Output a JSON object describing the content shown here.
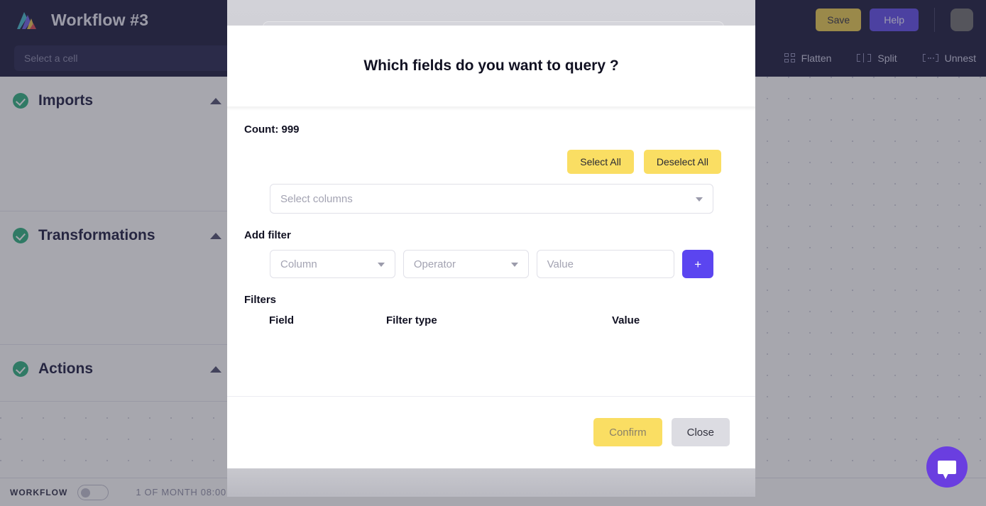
{
  "header": {
    "app_title": "Workflow #3",
    "logo_icon": "lyra-triangle-logo",
    "save_label": "Save",
    "help_label": "Help",
    "avatar_icon": "user-avatar",
    "cell_placeholder": "Select a cell",
    "tools": [
      {
        "label": "Flatten",
        "icon": "flatten-grid-icon"
      },
      {
        "label": "Split",
        "icon": "split-icon"
      },
      {
        "label": "Unnest",
        "icon": "unnest-brackets-icon"
      }
    ]
  },
  "sidebar": {
    "panels": [
      {
        "title": "Imports",
        "status_icon": "check-circle-icon",
        "chevron": "chevron-up-icon"
      },
      {
        "title": "Transformations",
        "status_icon": "check-circle-icon",
        "chevron": "chevron-up-icon"
      },
      {
        "title": "Actions",
        "status_icon": "check-circle-icon",
        "chevron": "chevron-up-icon"
      }
    ]
  },
  "statusbar": {
    "workflow_label": "WORKFLOW",
    "toggle_state": "off",
    "schedule": "1 OF MONTH 08:00"
  },
  "chat": {
    "icon": "chat-bubble-icon"
  },
  "modal": {
    "title": "Which fields do you want to query ?",
    "count_label": "Count: 999",
    "select_all_label": "Select All",
    "deselect_all_label": "Deselect All",
    "columns_placeholder": "Select columns",
    "add_filter_label": "Add filter",
    "column_placeholder": "Column",
    "operator_placeholder": "Operator",
    "value_placeholder": "Value",
    "add_button_label": "+",
    "filters_label": "Filters",
    "filters_columns": [
      "Field",
      "Filter type",
      "Value"
    ],
    "filters_rows": [],
    "confirm_label": "Confirm",
    "close_label": "Close"
  },
  "colors": {
    "navy": "#131335",
    "purple": "#5a45e8",
    "yellow": "#fade63",
    "green": "#27ae7a",
    "chat_purple": "#6a3ee0"
  }
}
